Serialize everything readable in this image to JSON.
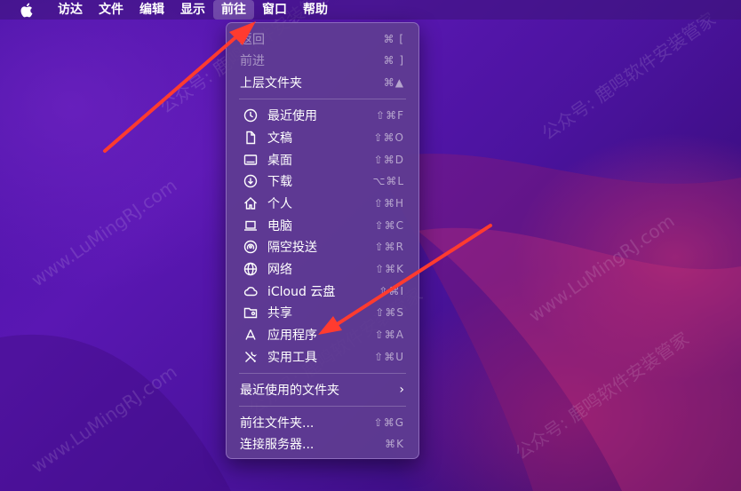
{
  "menubar": {
    "items": [
      {
        "label": "访达"
      },
      {
        "label": "文件"
      },
      {
        "label": "编辑"
      },
      {
        "label": "显示"
      },
      {
        "label": "前往"
      },
      {
        "label": "窗口"
      },
      {
        "label": "帮助"
      }
    ]
  },
  "menu": {
    "back": {
      "label": "返回",
      "shortcut": "⌘ ["
    },
    "forward": {
      "label": "前进",
      "shortcut": "⌘ ]"
    },
    "enclosing": {
      "label": "上层文件夹",
      "shortcut": "⌘▲"
    },
    "items": [
      {
        "label": "最近使用",
        "shortcut": "⇧⌘F",
        "icon": "clock-icon"
      },
      {
        "label": "文稿",
        "shortcut": "⇧⌘O",
        "icon": "document-icon"
      },
      {
        "label": "桌面",
        "shortcut": "⇧⌘D",
        "icon": "desktop-icon"
      },
      {
        "label": "下载",
        "shortcut": "⌥⌘L",
        "icon": "download-icon"
      },
      {
        "label": "个人",
        "shortcut": "⇧⌘H",
        "icon": "home-icon"
      },
      {
        "label": "电脑",
        "shortcut": "⇧⌘C",
        "icon": "laptop-icon"
      },
      {
        "label": "隔空投送",
        "shortcut": "⇧⌘R",
        "icon": "airdrop-icon"
      },
      {
        "label": "网络",
        "shortcut": "⇧⌘K",
        "icon": "globe-icon"
      },
      {
        "label": "iCloud 云盘",
        "shortcut": "⇧⌘I",
        "icon": "cloud-icon"
      },
      {
        "label": "共享",
        "shortcut": "⇧⌘S",
        "icon": "shared-folder-icon"
      },
      {
        "label": "应用程序",
        "shortcut": "⇧⌘A",
        "icon": "applications-icon"
      },
      {
        "label": "实用工具",
        "shortcut": "⇧⌘U",
        "icon": "tools-icon"
      }
    ],
    "recent_folders": {
      "label": "最近使用的文件夹"
    },
    "goto_folder": {
      "label": "前往文件夹...",
      "shortcut": "⇧⌘G"
    },
    "connect_server": {
      "label": "连接服务器...",
      "shortcut": "⌘K"
    }
  },
  "watermark": {
    "text1": "公众号: 鹿鸣软件安装管家",
    "text2": "www.LuMingRJ.com"
  }
}
